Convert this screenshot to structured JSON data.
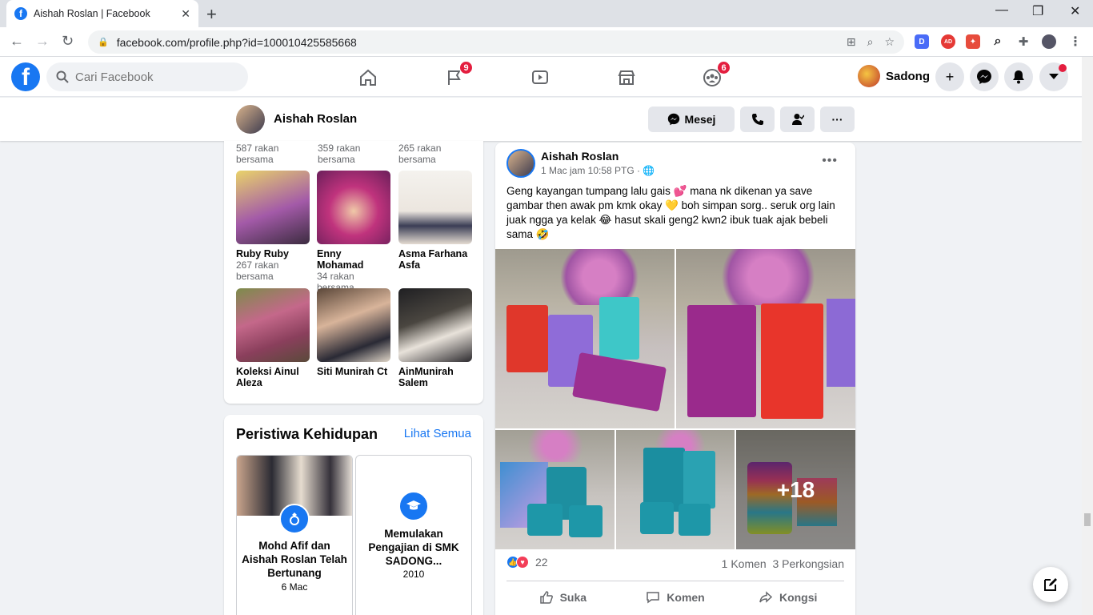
{
  "browser": {
    "tab_title": "Aishah Roslan | Facebook",
    "url": "facebook.com/profile.php?id=100010425585668",
    "ext_d": "D",
    "ext_ad": "AD"
  },
  "fb_header": {
    "search_placeholder": "Cari Facebook",
    "pages_badge": "9",
    "groups_badge": "6",
    "user_name": "Sadong"
  },
  "profile_bar": {
    "name": "Aishah Roslan",
    "message_label": "Mesej"
  },
  "friends": {
    "top_row_mutual": [
      {
        "count": "587 rakan",
        "suffix": "bersama"
      },
      {
        "count": "359 rakan",
        "suffix": "bersama"
      },
      {
        "count": "265 rakan",
        "suffix": "bersama"
      }
    ],
    "items": [
      {
        "name": "Ruby Ruby",
        "mutual": "267 rakan bersama"
      },
      {
        "name": "Enny Mohamad",
        "mutual": "34 rakan bersama"
      },
      {
        "name": "Asma Farhana Asfa",
        "mutual": ""
      },
      {
        "name": "Koleksi Ainul Aleza",
        "mutual": ""
      },
      {
        "name": "Siti Munirah Ct",
        "mutual": ""
      },
      {
        "name": "AinMunirah Salem",
        "mutual": ""
      }
    ]
  },
  "life_events": {
    "title": "Peristiwa Kehidupan",
    "see_all": "Lihat Semua",
    "events": [
      {
        "title": "Mohd Afif dan Aishah Roslan Telah Bertunang",
        "date": "6 Mac"
      },
      {
        "title": "Memulakan Pengajian di SMK SADONG...",
        "date": "2010"
      }
    ]
  },
  "post": {
    "author": "Aishah Roslan",
    "time": "1 Mac jam 10:58 PTG · ",
    "text": "Geng kayangan tumpang lalu gais 💕 mana nk dikenan ya save gambar then awak pm kmk okay 💛 boh simpan sorg.. seruk org lain juak ngga ya kelak 😂 hasut skali geng2 kwn2 ibuk tuak ajak bebeli sama 🤣",
    "more_photos": "+18",
    "reaction_count": "22",
    "comments": "1 Komen",
    "shares": "3 Perkongsian",
    "like_label": "Suka",
    "comment_label": "Komen",
    "share_label": "Kongsi"
  }
}
